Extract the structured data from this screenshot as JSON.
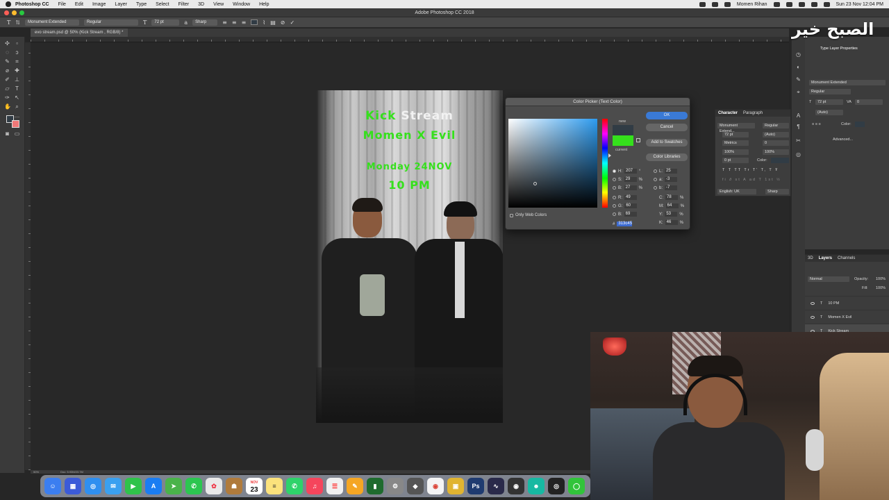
{
  "menubar": {
    "app_name": "Photoshop CC",
    "items": [
      "File",
      "Edit",
      "Image",
      "Layer",
      "Type",
      "Select",
      "Filter",
      "3D",
      "View",
      "Window",
      "Help"
    ],
    "user": "Momen Rihan",
    "datetime": "Sun 23 Nov  12:04 PM"
  },
  "window": {
    "title": "Adobe Photoshop CC 2018"
  },
  "options": {
    "font_family": "Monument Extended",
    "font_style": "Regular",
    "font_size": "72 pt",
    "antialias": "Sharp"
  },
  "document_tab": {
    "label": "evo stream.psd @ 50% (Kick Stream , RGB/8) *"
  },
  "poster": {
    "line1_green": "Kick",
    "line1_white": "Stream",
    "line2": "Momen X Evil",
    "line3": "Monday 24NOV",
    "line4": "10 PM"
  },
  "color_picker": {
    "title": "Color Picker (Text Color)",
    "new_label": "new",
    "current_label": "current",
    "ok": "OK",
    "cancel": "Cancel",
    "add_to_swatches": "Add to Swatches",
    "color_libraries": "Color Libraries",
    "only_web_colors": "Only Web Colors",
    "hsb": {
      "h": "207",
      "s": "29",
      "b": "27"
    },
    "rgb": {
      "r": "49",
      "g": "60",
      "b": "69"
    },
    "lab": {
      "l": "25",
      "a": "-3",
      "b": "-7"
    },
    "cmyk": {
      "c": "78",
      "m": "64",
      "y": "53",
      "k": "46"
    },
    "hex": "313c45",
    "new_color": "#313c45",
    "current_color": "#35e01c"
  },
  "character_panel": {
    "tabs": [
      "Character",
      "Paragraph"
    ],
    "font_family": "Monument Extend...",
    "font_style": "Regular",
    "size": "72 pt",
    "leading": "(Auto)",
    "kerning": "Metrics",
    "tracking": "0",
    "vscale": "100%",
    "hscale": "100%",
    "baseline": "0 pt",
    "color_label": "Color:",
    "language": "English: UK",
    "antialias": "Sharp"
  },
  "properties_panel": {
    "title": "Type Layer Properties",
    "font_family": "Monument Extended",
    "font_style": "Regular",
    "size": "72 pt",
    "tracking": "0",
    "leading": "(Auto)",
    "color_label": "Color:",
    "advanced": "Advanced..."
  },
  "layers_panel": {
    "tabs": [
      "3D",
      "Layers",
      "Channels"
    ],
    "blend": "Normal",
    "opacity_label": "Opacity:",
    "opacity": "100%",
    "fill_label": "Fill:",
    "fill": "100%",
    "layers": [
      "10 PM",
      "Momen X Evil",
      "Kick Stream"
    ]
  },
  "status": {
    "zoom": "50%",
    "doc": "Doc: 5.93M/23.7M"
  },
  "dock": {
    "calendar_day": "23",
    "calendar_month": "NOV"
  },
  "watermark": "الصبح خير"
}
